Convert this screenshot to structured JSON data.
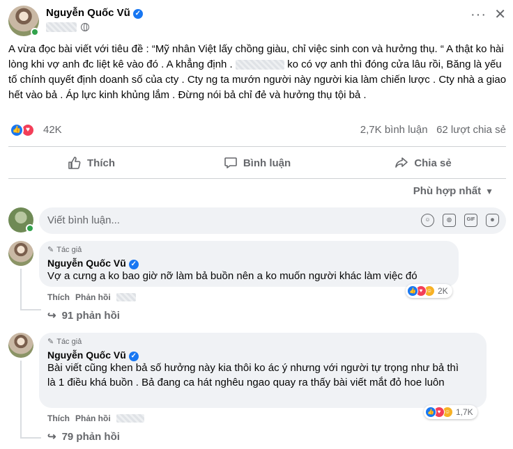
{
  "post": {
    "author": "Nguyễn Quốc Vũ",
    "body": "A vừa đọc bài viết với tiêu đề : “Mỹ nhân Việt lấy chồng giàu, chỉ việc sinh con và hưởng thụ. “ A thật ko hài lòng khi vợ anh đc liệt kê vào đó . A khẳng định . ██████ ko có vợ anh thì đóng cửa lâu rồi, Băng là yếu tố chính quyết định doanh số của cty . Cty ng ta mướn người này người kia làm chiến lược . Cty nhà a giao hết vào bả . Áp lực kinh khủng lắm . Đừng nói bả chỉ đẻ và hưởng thụ tội bả .",
    "body_before_redaction": "A vừa đọc bài viết với tiêu đề : “Mỹ nhân Việt lấy chồng giàu, chỉ việc sinh con và hưởng thụ. “ A thật ko hài lòng khi vợ anh đc liệt kê vào đó . A khẳng định .",
    "body_after_redaction": "ko có vợ anh thì đóng cửa lâu rồi, Băng là yếu tố chính quyết định doanh số của cty . Cty ng ta mướn người này người kia làm chiến lược . Cty nhà a giao hết vào bả . Áp lực kinh khủng lắm . Đừng nói bả chỉ đẻ và hưởng thụ tội bả .",
    "reaction_count": "42K",
    "comment_count": "2,7K bình luận",
    "share_count": "62 lượt chia sẻ"
  },
  "actions": {
    "like": "Thích",
    "comment": "Bình luận",
    "share": "Chia sẻ"
  },
  "sort_label": "Phù hợp nhất",
  "composer": {
    "placeholder": "Viết bình luận..."
  },
  "comments": [
    {
      "tag": "Tác giả",
      "author": "Nguyễn Quốc Vũ",
      "text": "Vợ a cưng a ko bao giờ nỡ làm bả buồn nên a ko muốn người khác làm việc đó",
      "like": "Thích",
      "reply": "Phản hồi",
      "reactions": "2K",
      "replies": "91 phản hồi"
    },
    {
      "tag": "Tác giả",
      "author": "Nguyễn Quốc Vũ",
      "text": "Bài viết cũng khen bả số hưởng này kia thôi ko ác ý nhưng với người tự trọng như bả thì là 1 điều khá buồn . Bả đang ca hát nghêu ngao quay ra thấy bài viết mắt đỏ hoe luôn",
      "like": "Thích",
      "reply": "Phản hồi",
      "reactions": "1,7K",
      "replies": "79 phản hồi"
    }
  ],
  "icons": {
    "like": "thumb-up-icon",
    "comment": "speech-bubble-icon",
    "share": "share-arrow-icon",
    "verified": "verified-badge-icon"
  },
  "colors": {
    "accent": "#1877f2",
    "love": "#f33e58",
    "care": "#f7b125",
    "secondary_text": "#65676b",
    "bubble_bg": "#f0f2f5",
    "online": "#31a24c"
  }
}
